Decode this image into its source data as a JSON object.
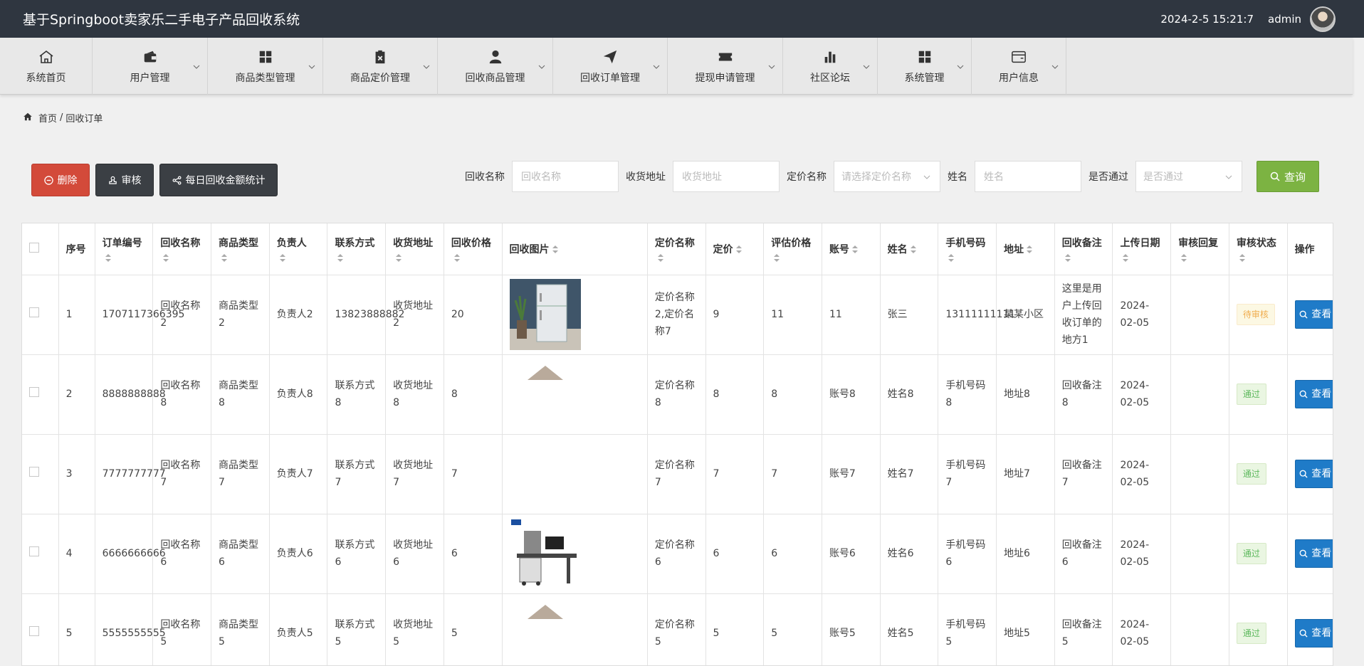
{
  "app": {
    "title": "基于Springboot卖家乐二手电子产品回收系统",
    "datetime": "2024-2-5 15:21:7",
    "username": "admin"
  },
  "nav": [
    {
      "label": "系统首页",
      "icon": "home-icon"
    },
    {
      "label": "用户管理",
      "icon": "wallet-icon"
    },
    {
      "label": "商品类型管理",
      "icon": "grid-icon"
    },
    {
      "label": "商品定价管理",
      "icon": "clipboard-x-icon"
    },
    {
      "label": "回收商品管理",
      "icon": "user-icon"
    },
    {
      "label": "回收订单管理",
      "icon": "paper-plane-icon"
    },
    {
      "label": "提现申请管理",
      "icon": "ticket-icon"
    },
    {
      "label": "社区论坛",
      "icon": "bar-chart-icon"
    },
    {
      "label": "系统管理",
      "icon": "grid-icon"
    },
    {
      "label": "用户信息",
      "icon": "card-icon"
    }
  ],
  "breadcrumb": {
    "home": "首页",
    "separator": "/",
    "current": "回收订单"
  },
  "actions": {
    "delete": "删除",
    "audit": "审核",
    "stats": "每日回收金额统计"
  },
  "search": {
    "name_label": "回收名称",
    "name_placeholder": "回收名称",
    "address_label": "收货地址",
    "address_placeholder": "收货地址",
    "price_label": "定价名称",
    "price_placeholder": "请选择定价名称",
    "person_label": "姓名",
    "person_placeholder": "姓名",
    "pass_label": "是否通过",
    "pass_placeholder": "是否通过",
    "query": "查询"
  },
  "table": {
    "headers": {
      "index": "序号",
      "order_no": "订单编号",
      "name": "回收名称",
      "type": "商品类型",
      "owner": "负责人",
      "contact": "联系方式",
      "address": "收货地址",
      "price": "回收价格",
      "image": "回收图片",
      "pricing_name": "定价名称",
      "pricing": "定价",
      "estimate": "评估价格",
      "account": "账号",
      "person": "姓名",
      "phone": "手机号码",
      "addr": "地址",
      "note": "回收备注",
      "date": "上传日期",
      "reply": "审核回复",
      "status": "审核状态",
      "ops": "操作"
    },
    "view_label": "查看",
    "rows": [
      {
        "index": "1",
        "order_no": "1707117366395",
        "name": "回收名称2",
        "type": "商品类型2",
        "owner": "负责人2",
        "contact": "13823888882",
        "address": "收货地址2",
        "price": "20",
        "image": "fridge-image",
        "pricing_name": "定价名称2,定价名称7",
        "pricing": "9",
        "estimate": "11",
        "account": "11",
        "person": "张三",
        "phone": "13111111111",
        "addr": "某某小区",
        "note": "这里是用户上传回收订单的地方1",
        "date": "2024-02-05",
        "reply": "",
        "status": "待审核",
        "status_kind": "wait"
      },
      {
        "index": "2",
        "order_no": "8888888888",
        "name": "回收名称8",
        "type": "商品类型8",
        "owner": "负责人8",
        "contact": "联系方式8",
        "address": "收货地址8",
        "price": "8",
        "image": "partial-image",
        "pricing_name": "定价名称8",
        "pricing": "8",
        "estimate": "8",
        "account": "账号8",
        "person": "姓名8",
        "phone": "手机号码8",
        "addr": "地址8",
        "note": "回收备注8",
        "date": "2024-02-05",
        "reply": "",
        "status": "通过",
        "status_kind": "ok"
      },
      {
        "index": "3",
        "order_no": "7777777777",
        "name": "回收名称7",
        "type": "商品类型7",
        "owner": "负责人7",
        "contact": "联系方式7",
        "address": "收货地址7",
        "price": "7",
        "image": "",
        "pricing_name": "定价名称7",
        "pricing": "7",
        "estimate": "7",
        "account": "账号7",
        "person": "姓名7",
        "phone": "手机号码7",
        "addr": "地址7",
        "note": "回收备注7",
        "date": "2024-02-05",
        "reply": "",
        "status": "通过",
        "status_kind": "ok"
      },
      {
        "index": "4",
        "order_no": "6666666666",
        "name": "回收名称6",
        "type": "商品类型6",
        "owner": "负责人6",
        "contact": "联系方式6",
        "address": "收货地址6",
        "price": "6",
        "image": "workstation-image",
        "pricing_name": "定价名称6",
        "pricing": "6",
        "estimate": "6",
        "account": "账号6",
        "person": "姓名6",
        "phone": "手机号码6",
        "addr": "地址6",
        "note": "回收备注6",
        "date": "2024-02-05",
        "reply": "",
        "status": "通过",
        "status_kind": "ok"
      },
      {
        "index": "5",
        "order_no": "5555555555",
        "name": "回收名称5",
        "type": "商品类型5",
        "owner": "负责人5",
        "contact": "联系方式5",
        "address": "收货地址5",
        "price": "5",
        "image": "partial-image",
        "pricing_name": "定价名称5",
        "pricing": "5",
        "estimate": "5",
        "account": "账号5",
        "person": "姓名5",
        "phone": "手机号码5",
        "addr": "地址5",
        "note": "回收备注5",
        "date": "2024-02-05",
        "reply": "",
        "status": "通过",
        "status_kind": "ok"
      }
    ]
  }
}
